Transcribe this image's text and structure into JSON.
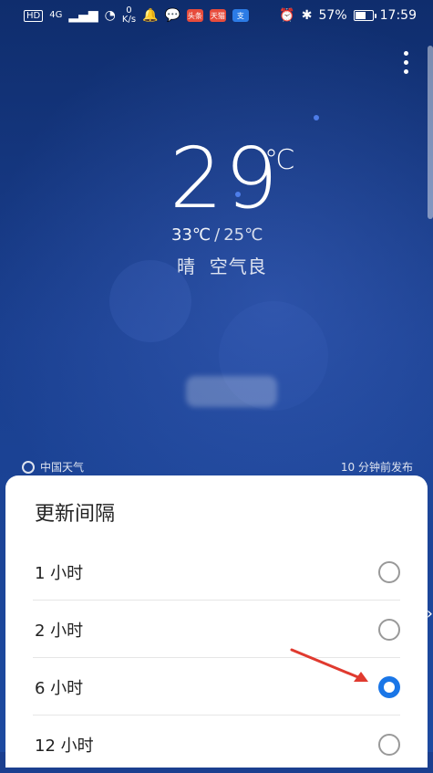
{
  "status_bar": {
    "left_indicators": [
      "HD",
      "4G"
    ],
    "net_speed_value": "0",
    "net_speed_unit": "K/s",
    "battery": "57%",
    "battery_fill_fraction": 0.57,
    "time": "17:59",
    "app_chips": [
      {
        "label": "头条",
        "color": "#e74c3c"
      },
      {
        "label": "天猫",
        "color": "#e74c3c"
      },
      {
        "label": "支",
        "color": "#2c7be5"
      }
    ]
  },
  "weather": {
    "current_temp": "29",
    "unit": "℃",
    "high": "33℃",
    "low": "25℃",
    "separator": "/",
    "condition": "晴",
    "air_quality": "空气良"
  },
  "footer": {
    "source": "中国天气",
    "published": "10 分钟前发布"
  },
  "sheet": {
    "title": "更新间隔",
    "options": [
      {
        "label": "1 小时",
        "selected": false
      },
      {
        "label": "2 小时",
        "selected": false
      },
      {
        "label": "6 小时",
        "selected": true
      },
      {
        "label": "12 小时",
        "selected": false
      }
    ]
  },
  "colors": {
    "accent": "#1a76e7",
    "arrow": "#e03a2f"
  }
}
